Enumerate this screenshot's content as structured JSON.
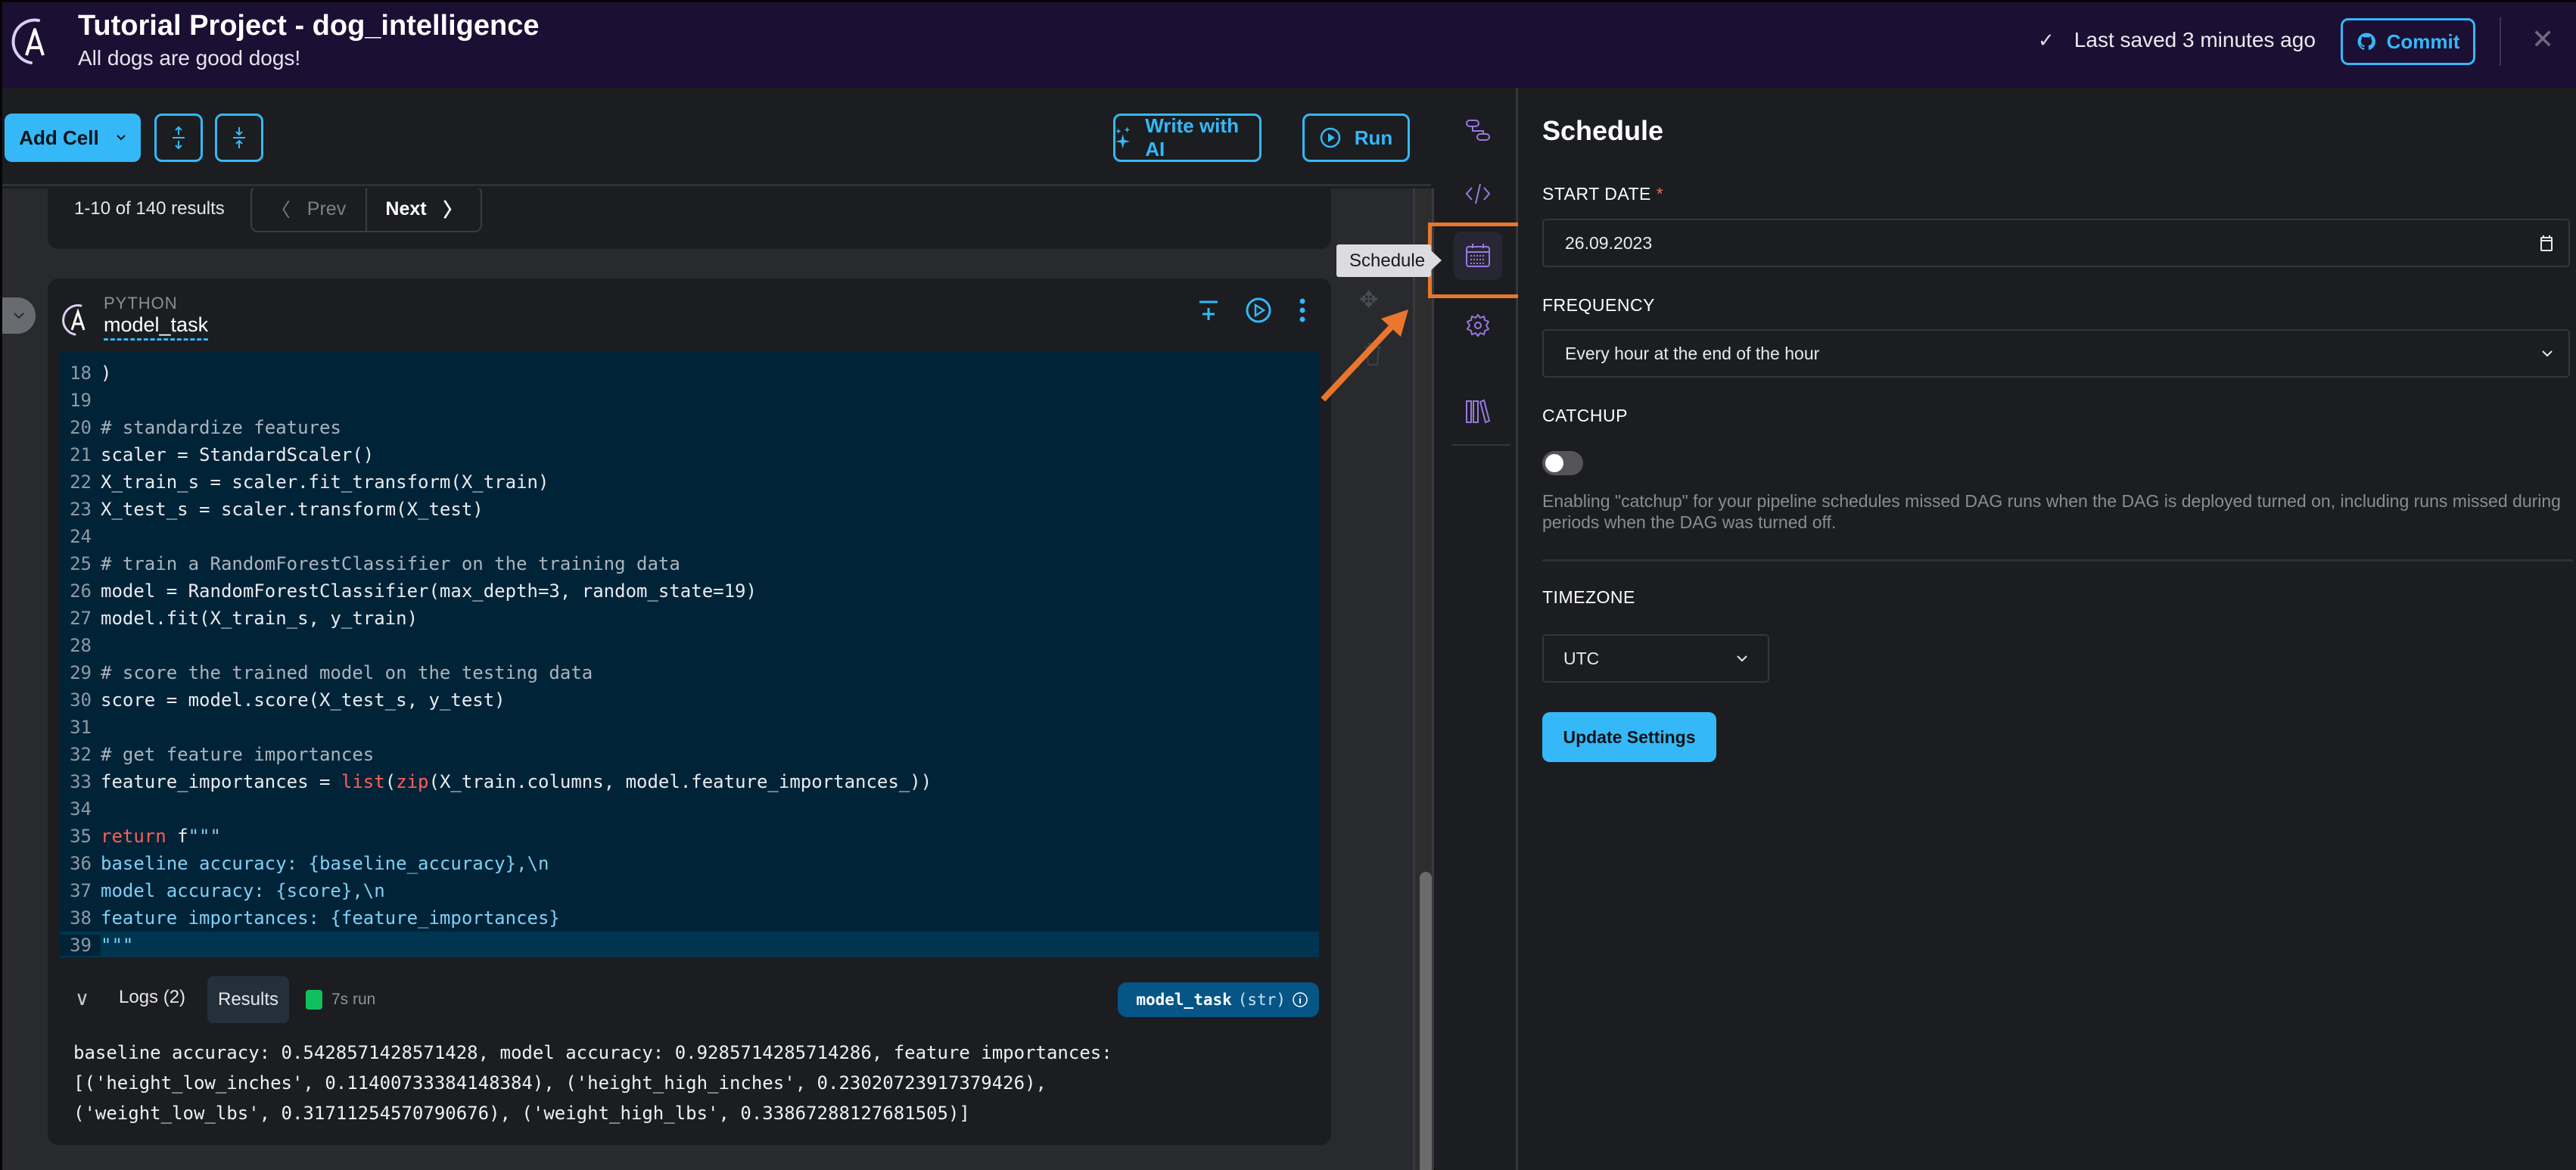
{
  "header": {
    "title": "Tutorial Project - dog_intelligence",
    "subtitle": "All dogs are good dogs!",
    "save_status": "Last saved 3 minutes ago",
    "commit_label": "Commit"
  },
  "toolbar": {
    "add_cell_label": "Add Cell",
    "expand_all_icon": "expand-vertical-icon",
    "collapse_all_icon": "collapse-vertical-icon",
    "write_ai_label": "Write with AI",
    "run_label": "Run"
  },
  "pager": {
    "count": "1-10 of 140 results",
    "prev_label": "Prev",
    "next_label": "Next"
  },
  "cell": {
    "language": "PYTHON",
    "name": "model_task",
    "code": [
      {
        "n": "18",
        "html": ")"
      },
      {
        "n": "19",
        "html": ""
      },
      {
        "n": "20",
        "html": "<span class=\"cm\"># standardize features</span>"
      },
      {
        "n": "21",
        "html": "scaler = StandardScaler()"
      },
      {
        "n": "22",
        "html": "X_train_s = scaler.fit_transform(X_train)"
      },
      {
        "n": "23",
        "html": "X_test_s = scaler.transform(X_test)"
      },
      {
        "n": "24",
        "html": ""
      },
      {
        "n": "25",
        "html": "<span class=\"cm\"># train a RandomForestClassifier on the training data</span>"
      },
      {
        "n": "26",
        "html": "model = RandomForestClassifier(max_depth=3, random_state=19)"
      },
      {
        "n": "27",
        "html": "model.fit(X_train_s, y_train)"
      },
      {
        "n": "28",
        "html": ""
      },
      {
        "n": "29",
        "html": "<span class=\"cm\"># score the trained model on the testing data</span>"
      },
      {
        "n": "30",
        "html": "score = model.score(X_test_s, y_test)"
      },
      {
        "n": "31",
        "html": ""
      },
      {
        "n": "32",
        "html": "<span class=\"cm\"># get feature importances</span>"
      },
      {
        "n": "33",
        "html": "feature_importances = <span class=\"kw\">list</span>(<span class=\"kw\">zip</span>(X_train.columns, model.feature_importances_))"
      },
      {
        "n": "34",
        "html": ""
      },
      {
        "n": "35",
        "html": "<span class=\"kw\">return</span> f<span class=\"st\">\"\"\"</span>"
      },
      {
        "n": "36",
        "html": "<span class=\"st\">baseline accuracy: {baseline_accuracy},\\n</span>"
      },
      {
        "n": "37",
        "html": "<span class=\"st\">model accuracy: {score},\\n</span>"
      },
      {
        "n": "38",
        "html": "<span class=\"st\">feature importances: {feature_importances}</span>"
      },
      {
        "n": "39",
        "html": "<span class=\"st\">\"\"\"</span>"
      }
    ],
    "active_line": "39",
    "logs_label": "Logs (2)",
    "results_label": "Results",
    "run_time": "7s run",
    "output_name": "model_task",
    "output_type": "(str)",
    "output_text": "baseline accuracy: 0.5428571428571428, model accuracy: 0.9285714285714286, feature importances:\n[('height_low_inches', 0.11400733384148384), ('height_high_inches', 0.23020723917379426),\n('weight_low_lbs', 0.31711254570790676), ('weight_high_lbs', 0.33867288127681505)]"
  },
  "rail": {
    "items": [
      {
        "name": "pipeline-icon",
        "label": "Pipeline"
      },
      {
        "name": "code-icon",
        "label": "Code"
      },
      {
        "name": "calendar-icon",
        "label": "Schedule",
        "active": true
      },
      {
        "name": "gear-icon",
        "label": "Settings"
      },
      {
        "name": "library-icon",
        "label": "Library"
      }
    ],
    "tooltip": "Schedule"
  },
  "schedule": {
    "title": "Schedule",
    "start_date_label": "START DATE",
    "required_mark": "*",
    "start_date_value": "26.09.2023",
    "frequency_label": "FREQUENCY",
    "frequency_value": "Every hour at the end of the hour",
    "catchup_label": "CATCHUP",
    "catchup_enabled": false,
    "catchup_help": "Enabling \"catchup\" for your pipeline schedules missed DAG runs when the DAG is deployed turned on, including runs missed during periods when the DAG was turned off.",
    "timezone_label": "TIMEZONE",
    "timezone_value": "UTC",
    "update_label": "Update Settings"
  },
  "colors": {
    "accent": "#35b8f8",
    "header_bg": "#1b0f33",
    "annotation": "#e8762d",
    "rail_icon": "#9a78e0"
  }
}
